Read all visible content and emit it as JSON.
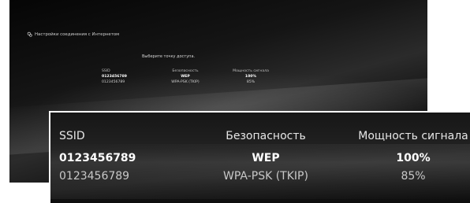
{
  "header": {
    "title": "Настройки соединения с Интернетом",
    "icon": "network-settings-icon"
  },
  "prompt": "Выберите точку доступа.",
  "table": {
    "columns": [
      "SSID",
      "Безопасность",
      "Мощность сигнала"
    ],
    "rows": [
      {
        "ssid": "0123456789",
        "security": "WEP",
        "signal": "100%",
        "selected": true
      },
      {
        "ssid": "0123456789",
        "security": "WPA-PSK (TKIP)",
        "signal": "85%",
        "selected": false
      }
    ]
  }
}
